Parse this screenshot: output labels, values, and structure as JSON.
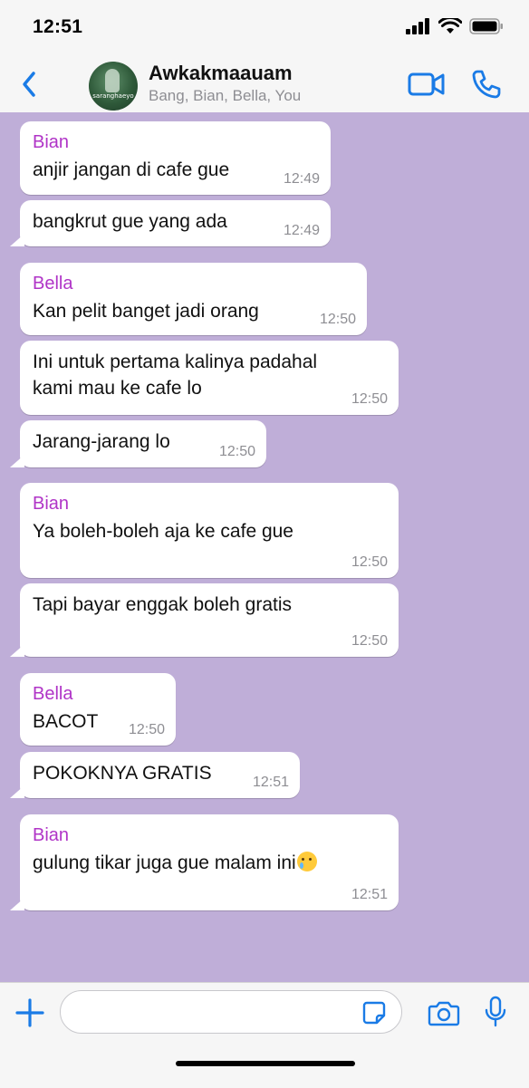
{
  "status_bar": {
    "time": "12:51",
    "icons": [
      "signal-icon",
      "wifi-icon",
      "battery-icon"
    ]
  },
  "header": {
    "title": "Awkakmaauam",
    "members": "Bang, Bian, Bella, You",
    "avatar_text": "saranghaeyo",
    "icons": [
      "back-chevron-icon",
      "video-call-icon",
      "phone-call-icon"
    ]
  },
  "colors": {
    "chat_background": "#bfaed8",
    "accent_blue": "#1a7be6",
    "sender_bian": "#b034c7",
    "sender_bella": "#b034c7"
  },
  "messages": [
    {
      "sender": "Bian",
      "text": "anjir jangan di cafe gue",
      "time": "12:49"
    },
    {
      "sender": "",
      "text": "bangkrut gue yang ada",
      "time": "12:49"
    },
    {
      "sender": "Bella",
      "text": "Kan pelit banget jadi orang",
      "time": "12:50"
    },
    {
      "sender": "",
      "text": "Ini untuk pertama kalinya padahal\nkami mau ke cafe lo",
      "time": "12:50"
    },
    {
      "sender": "",
      "text": "Jarang-jarang lo",
      "time": "12:50"
    },
    {
      "sender": "Bian",
      "text": "Ya boleh-boleh aja ke cafe gue",
      "time": "12:50"
    },
    {
      "sender": "",
      "text": "Tapi bayar enggak boleh gratis",
      "time": "12:50"
    },
    {
      "sender": "Bella",
      "text": "BACOT",
      "time": "12:50"
    },
    {
      "sender": "",
      "text": "POKOKNYA GRATIS",
      "time": "12:51"
    },
    {
      "sender": "Bian",
      "text": "gulung tikar juga gue malam ini",
      "emoji": "crying-face-emoji",
      "time": "12:51"
    }
  ],
  "composer": {
    "placeholder": "",
    "icons": [
      "plus-icon",
      "sticker-icon",
      "camera-icon",
      "microphone-icon"
    ]
  }
}
